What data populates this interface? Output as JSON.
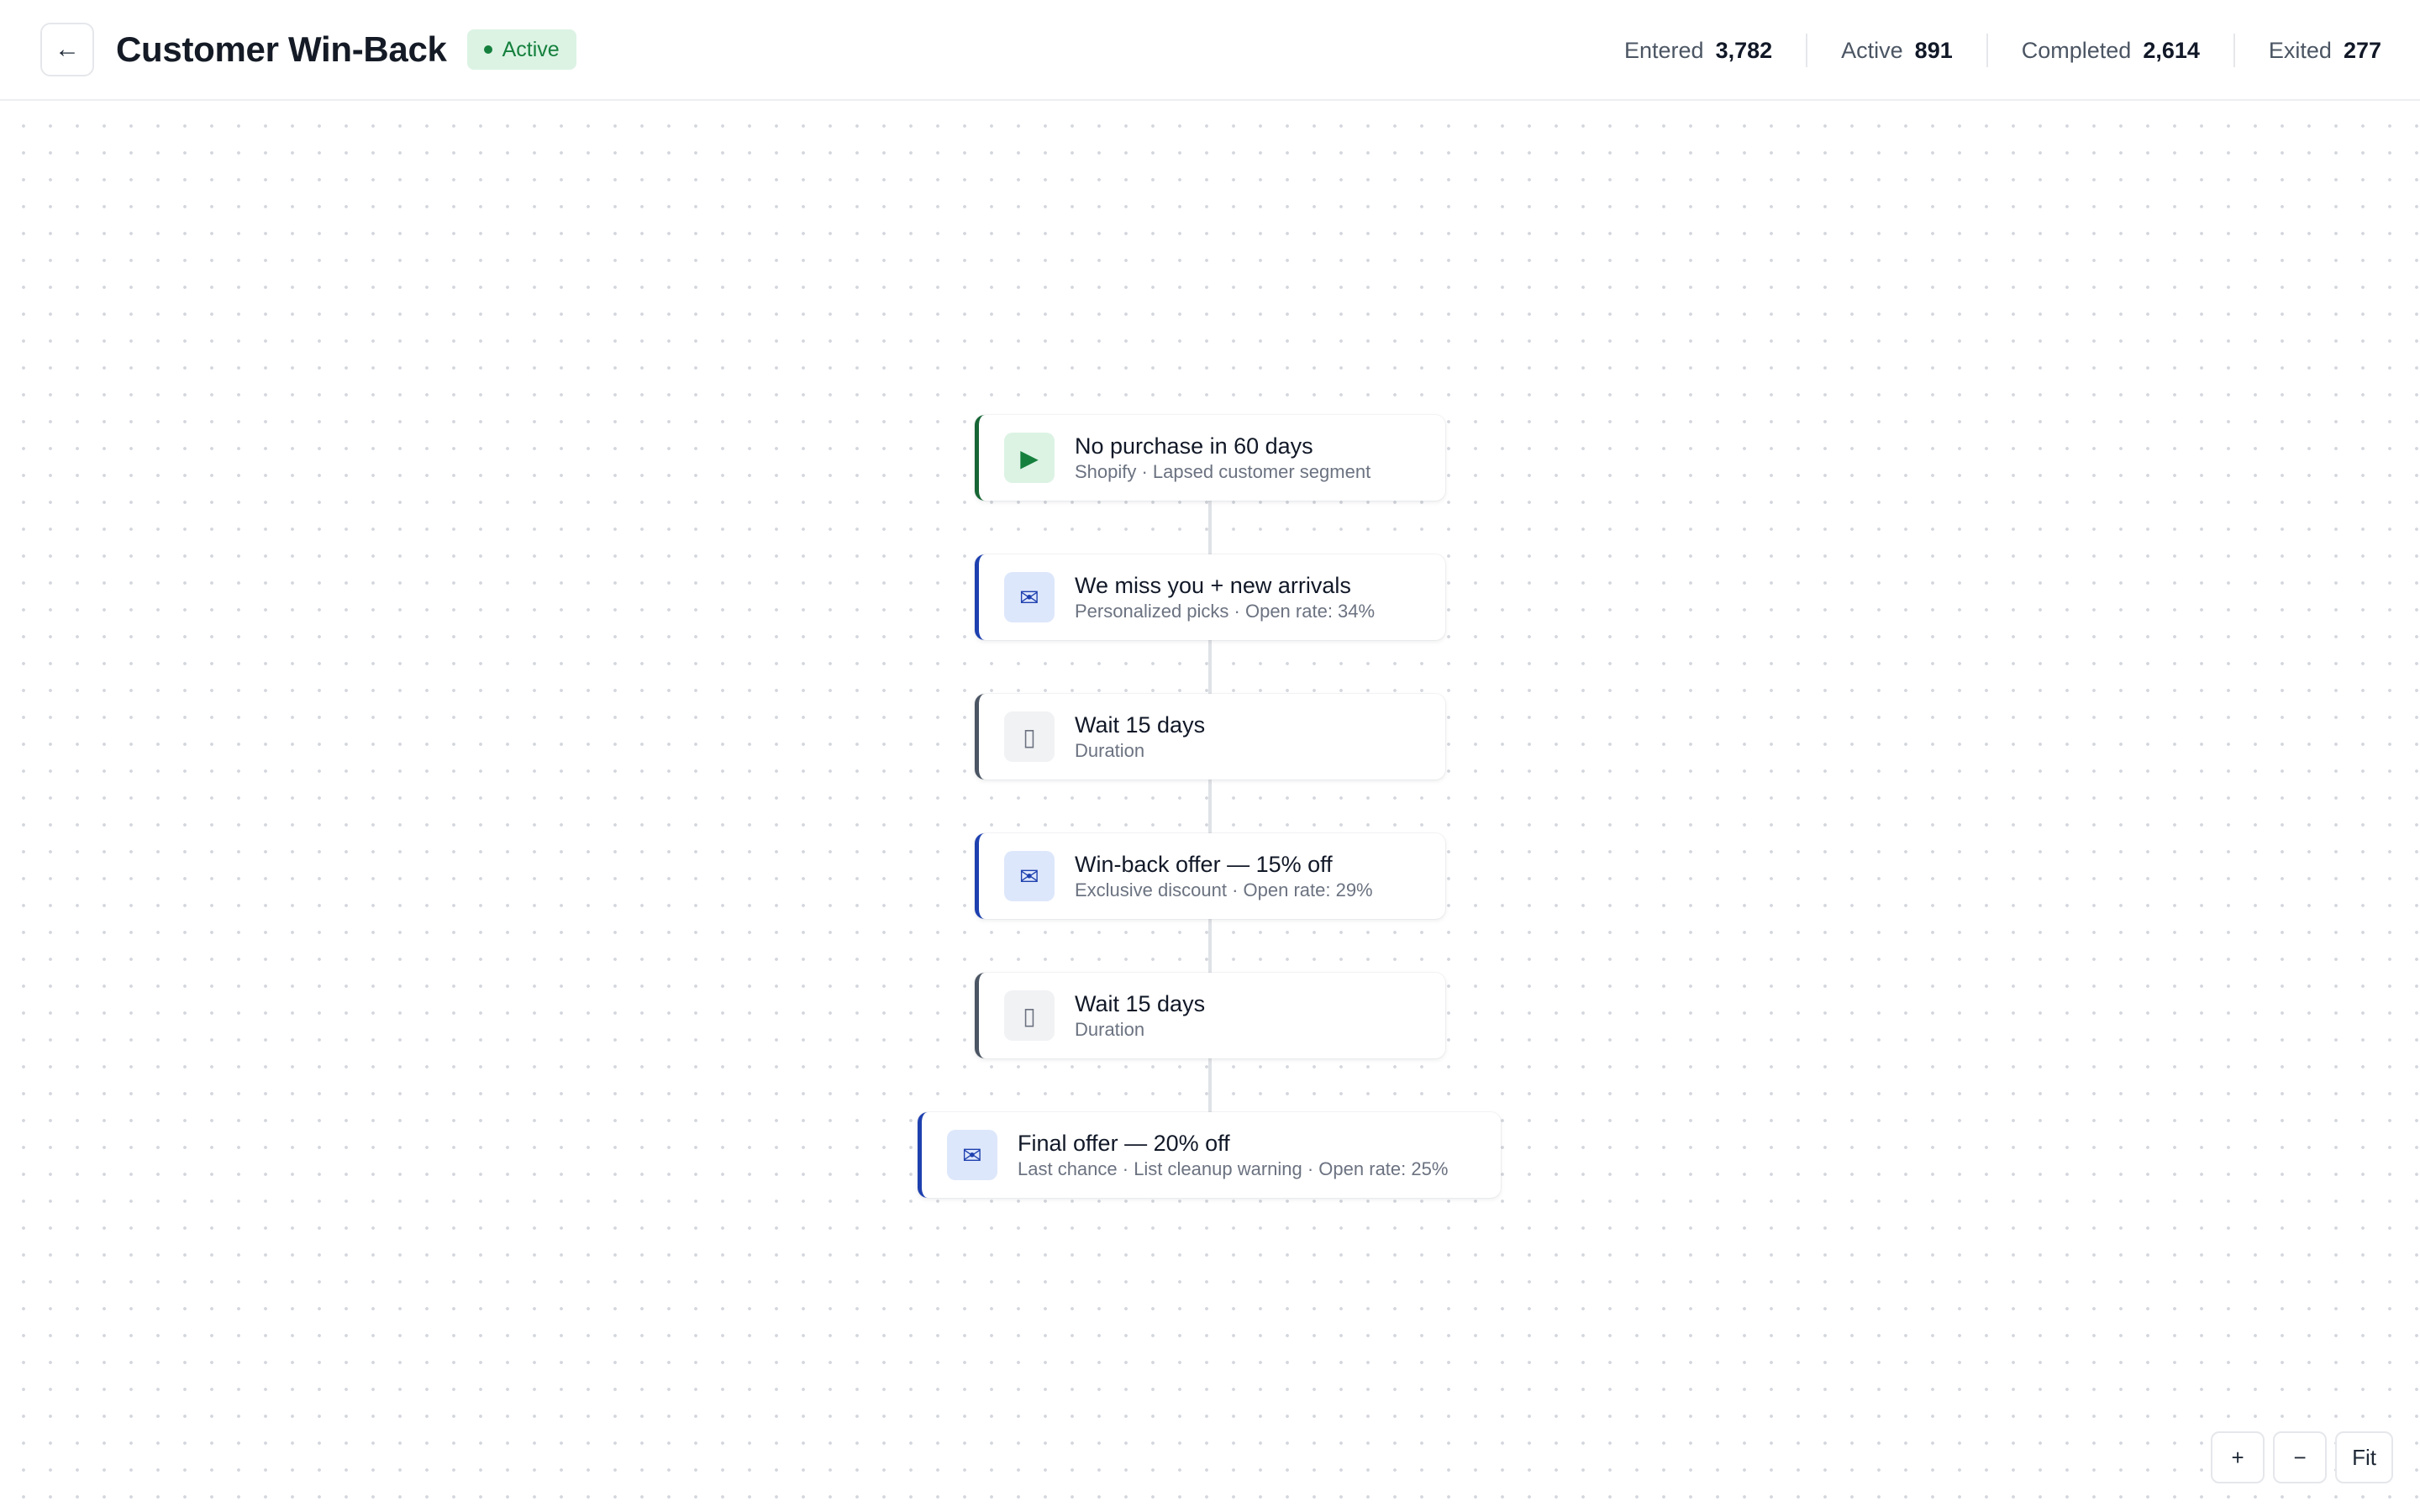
{
  "header": {
    "back_icon": "←",
    "title": "Customer Win-Back",
    "status": "Active",
    "status_color": "#15803d",
    "stats": [
      {
        "label": "Entered",
        "value": "3,782"
      },
      {
        "label": "Active",
        "value": "891"
      },
      {
        "label": "Completed",
        "value": "2,614"
      },
      {
        "label": "Exited",
        "value": "277"
      }
    ]
  },
  "nodes": [
    {
      "type": "trigger",
      "icon": "▶",
      "icon_name": "play-icon",
      "title": "No purchase in 60 days",
      "subtitle": "Shopify · Lapsed customer segment"
    },
    {
      "type": "email",
      "icon": "✉",
      "icon_name": "mail-icon",
      "title": "We miss you + new arrivals",
      "subtitle": "Personalized picks · Open rate: 34%"
    },
    {
      "type": "wait",
      "icon": "▯",
      "icon_name": "hourglass-icon",
      "title": "Wait 15 days",
      "subtitle": "Duration"
    },
    {
      "type": "email",
      "icon": "✉",
      "icon_name": "mail-icon",
      "title": "Win-back offer — 15% off",
      "subtitle": "Exclusive discount · Open rate: 29%"
    },
    {
      "type": "wait",
      "icon": "▯",
      "icon_name": "hourglass-icon",
      "title": "Wait 15 days",
      "subtitle": "Duration"
    },
    {
      "type": "email",
      "icon": "✉",
      "icon_name": "mail-icon",
      "title": "Final offer — 20% off",
      "subtitle": "Last chance · List cleanup warning · Open rate: 25%"
    }
  ],
  "zoom": {
    "zoom_in": "+",
    "zoom_out": "−",
    "fit": "Fit"
  },
  "colors": {
    "trigger_accent": "#166534",
    "email_accent": "#1e40af",
    "wait_accent": "#4b5563"
  }
}
